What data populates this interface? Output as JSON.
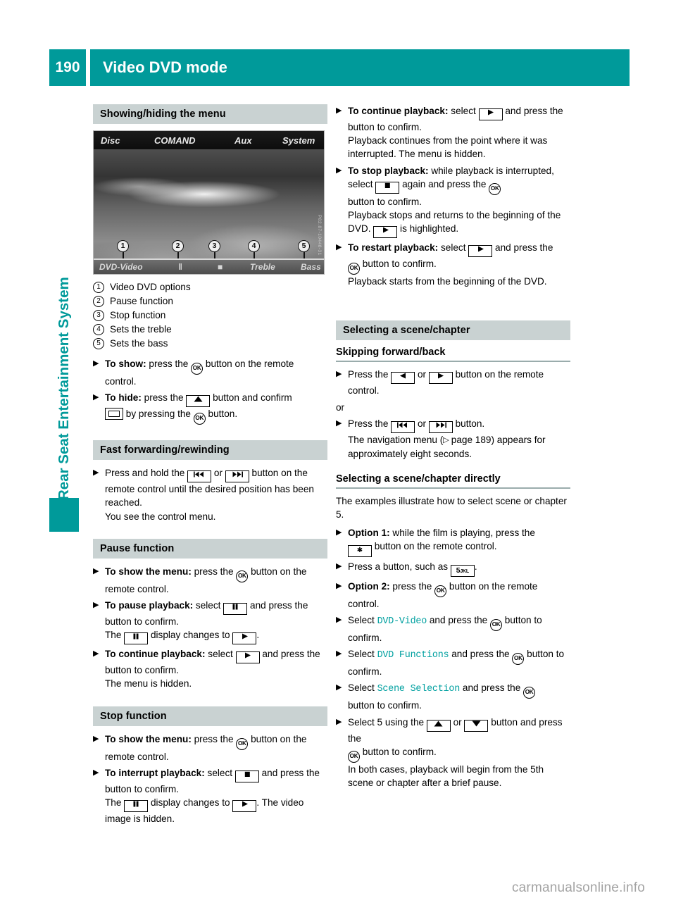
{
  "header": {
    "page_number": "190",
    "title": "Video DVD mode"
  },
  "sidebar": {
    "tab_label": "Rear Seat Entertainment System"
  },
  "figure": {
    "top_menu": [
      "Disc",
      "COMAND",
      "Aux",
      "System"
    ],
    "bottom_bar": [
      "DVD-Video",
      "‖",
      "■",
      "Treble",
      "Bass"
    ],
    "callouts": [
      "1",
      "2",
      "3",
      "4",
      "5"
    ],
    "credit": "P82.87-10448-31"
  },
  "left_column": {
    "section1_heading": "Showing/hiding the menu",
    "legend": [
      {
        "num": "1",
        "label": "Video DVD options"
      },
      {
        "num": "2",
        "label": "Pause function"
      },
      {
        "num": "3",
        "label": "Stop function"
      },
      {
        "num": "4",
        "label": "Sets the treble"
      },
      {
        "num": "5",
        "label": "Sets the bass"
      }
    ],
    "show_step_bold": "To show:",
    "show_step_t1": " press the ",
    "show_step_t2": " button on the remote control.",
    "hide_step_bold": "To hide:",
    "hide_step_t1": " press the ",
    "hide_step_t2": " button and confirm",
    "hide_step_t3": " by pressing the ",
    "hide_step_t4": " button.",
    "section2_heading": "Fast forwarding/rewinding",
    "ff_t1": "Press and hold the ",
    "ff_t2": " or ",
    "ff_t3": " button on the remote control until the desired position has been reached.",
    "ff_t4": "You see the control menu.",
    "section3_heading": "Pause function",
    "p_show_bold": "To show the menu:",
    "p_show_t1": " press the ",
    "p_show_t2": " button on the remote control.",
    "p_pause_bold": "To pause playback:",
    "p_pause_t1": " select ",
    "p_pause_t2": " and press the ",
    "p_pause_t3": " button to confirm.",
    "p_pause_t4": "The ",
    "p_pause_t5": " display changes to ",
    "p_pause_t6": ".",
    "p_cont_bold": "To continue playback:",
    "p_cont_t1": " select ",
    "p_cont_t2": " and press the ",
    "p_cont_t3": " button to confirm.",
    "p_cont_t4": "The menu is hidden.",
    "section4_heading": "Stop function",
    "s_show_bold": "To show the menu:",
    "s_show_t1": " press the ",
    "s_show_t2": " button on the remote control.",
    "s_int_bold": "To interrupt playback:",
    "s_int_t1": " select ",
    "s_int_t2": " and press the ",
    "s_int_t3": " button to confirm.",
    "s_int_t4": "The ",
    "s_int_t5": " display changes to ",
    "s_int_t6": ". The video image is hidden."
  },
  "right_column": {
    "r_cont_bold": "To continue playback:",
    "r_cont_t1": " select ",
    "r_cont_t2": " and press the ",
    "r_cont_t3": " button to confirm.",
    "r_cont_t4": "Playback continues from the point where it was interrupted. The menu is hidden.",
    "r_stop_bold": "To stop playback:",
    "r_stop_t1": " while playback is interrupted, select ",
    "r_stop_t2": " again and press the ",
    "r_stop_t3": " button to confirm.",
    "r_stop_t4": "Playback stops and returns to the beginning of the DVD. ",
    "r_stop_t5": " is highlighted.",
    "r_restart_bold": "To restart playback:",
    "r_restart_t1": " select ",
    "r_restart_t2": " and press the ",
    "r_restart_t3": " button to confirm.",
    "r_restart_t4": "Playback starts from the beginning of the DVD.",
    "section_heading": "Selecting a scene/chapter",
    "sub1_heading": "Skipping forward/back",
    "sk_t1": "Press the ",
    "sk_t2": " or ",
    "sk_t3": " button on the remote control.",
    "sk_or": "or",
    "sk2_t1": "Press the ",
    "sk2_t2": " or ",
    "sk2_t3": " button.",
    "sk2_t4a": "The navigation menu (",
    "sk2_ref": "page 189",
    "sk2_t4b": ") appears for approximately eight seconds.",
    "sub2_heading": "Selecting a scene/chapter directly",
    "intro": "The examples illustrate how to select scene or chapter 5.",
    "o1_bold": "Option 1:",
    "o1_t1": " while the film is playing, press the ",
    "o1_t2": " button on the remote control.",
    "o1b_t1": "Press a button, such as ",
    "o1b_key": "5",
    "o1b_key_sub": "JKL",
    "o1b_t2": ".",
    "o2_bold": "Option 2:",
    "o2_t1": " press the ",
    "o2_t2": " button on the remote control.",
    "sel1_t1": "Select ",
    "sel1_menu": "DVD-Video",
    "sel1_t2": " and press the ",
    "sel1_t3": " button to confirm.",
    "sel2_t1": "Select ",
    "sel2_menu": "DVD Functions",
    "sel2_t2": " and press the ",
    "sel2_t3": " button to confirm.",
    "sel3_t1": "Select ",
    "sel3_menu": "Scene Selection",
    "sel3_t2": " and press the ",
    "sel3_t3": " button to confirm.",
    "sel4_t1": "Select 5 using the ",
    "sel4_t2": " or ",
    "sel4_t3": " button and press the ",
    "sel4_t4": " button to confirm.",
    "sel4_t5": "In both cases, playback will begin from the 5th scene or chapter after a brief pause."
  },
  "watermark": "carmanualsonline.info",
  "icons": {
    "ok": "OK",
    "bullet": "▶"
  },
  "colors": {
    "accent_teal": "#009a9a",
    "heading_bg": "#c9d2d2",
    "menu_text_teal": "#00a0a0"
  }
}
